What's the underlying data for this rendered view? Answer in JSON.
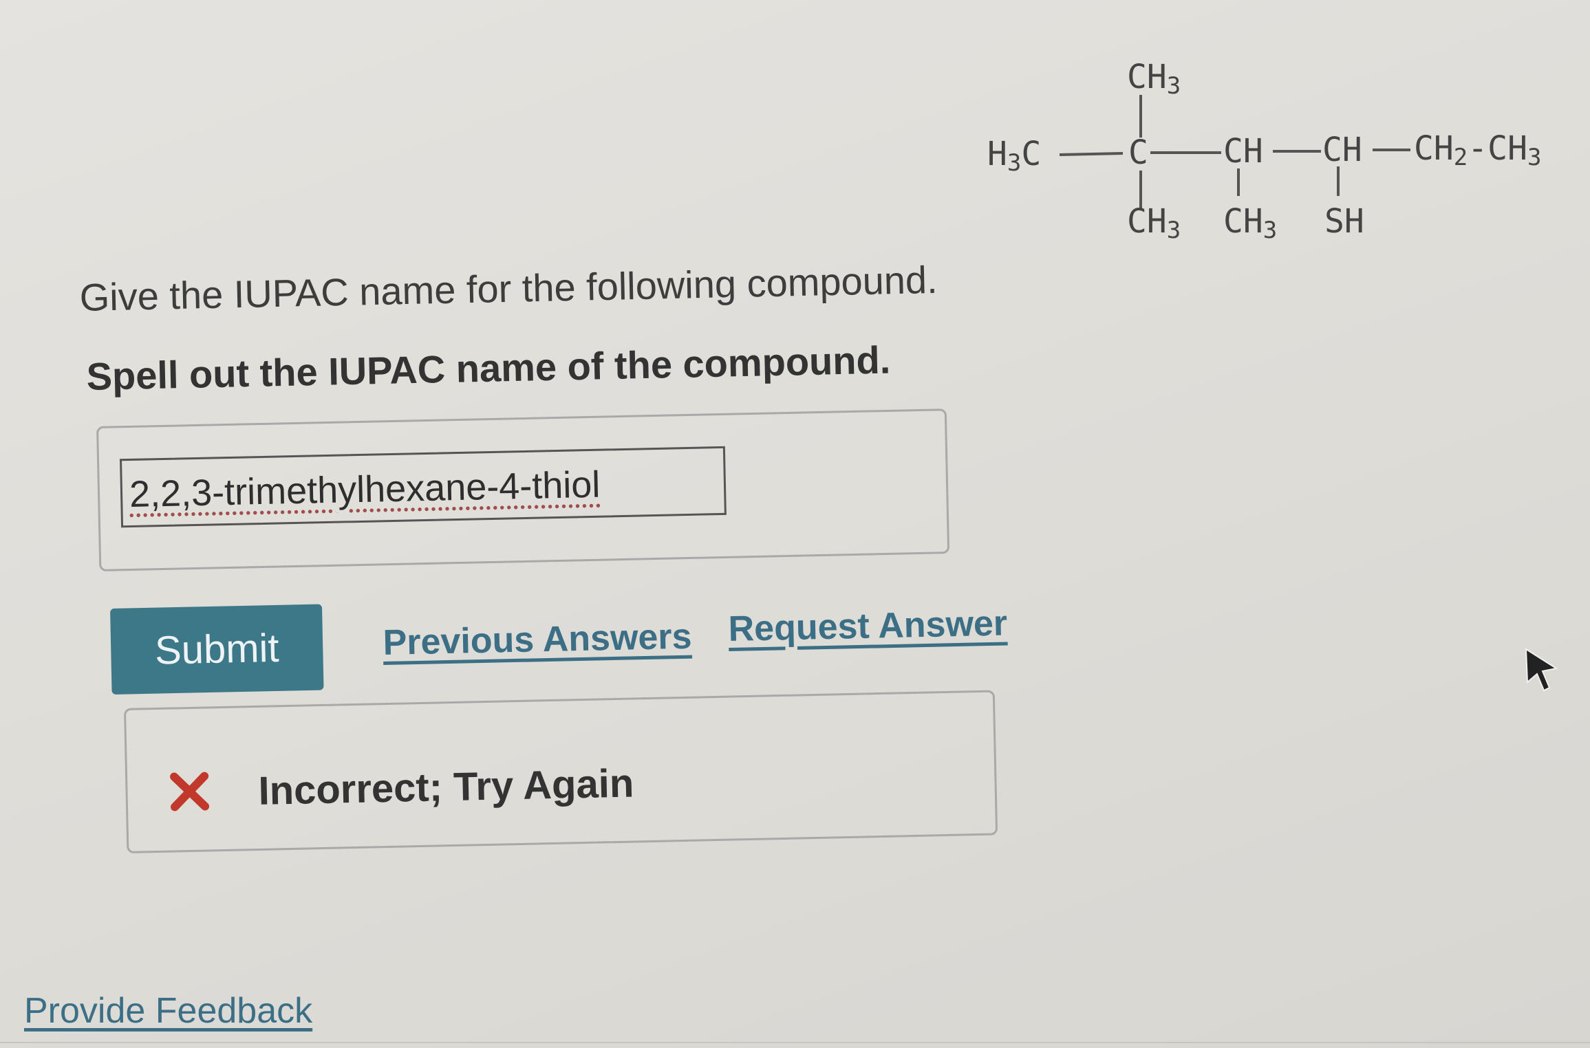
{
  "structure": {
    "top_group": "CH3",
    "left_group": "H3C",
    "c2": "C",
    "c3": "CH",
    "c4": "CH",
    "tail": "CH2-CH3",
    "sub_c2": "CH3",
    "sub_c3": "CH3",
    "sub_c4": "SH"
  },
  "question": {
    "line1": "Give the IUPAC name for the following compound.",
    "line2": "Spell out the IUPAC name of the compound."
  },
  "answer": {
    "value": "2,2,3-trimethylhexane-4-thiol"
  },
  "actions": {
    "submit_label": "Submit",
    "previous_answers_label": "Previous Answers",
    "request_answer_label": "Request Answer"
  },
  "feedback": {
    "status_text": "Incorrect; Try Again",
    "status_color": "#c0392b"
  },
  "footer": {
    "provide_feedback_label": "Provide Feedback"
  },
  "icons": {
    "status_icon": "x-icon",
    "cursor": "cursor-icon"
  }
}
